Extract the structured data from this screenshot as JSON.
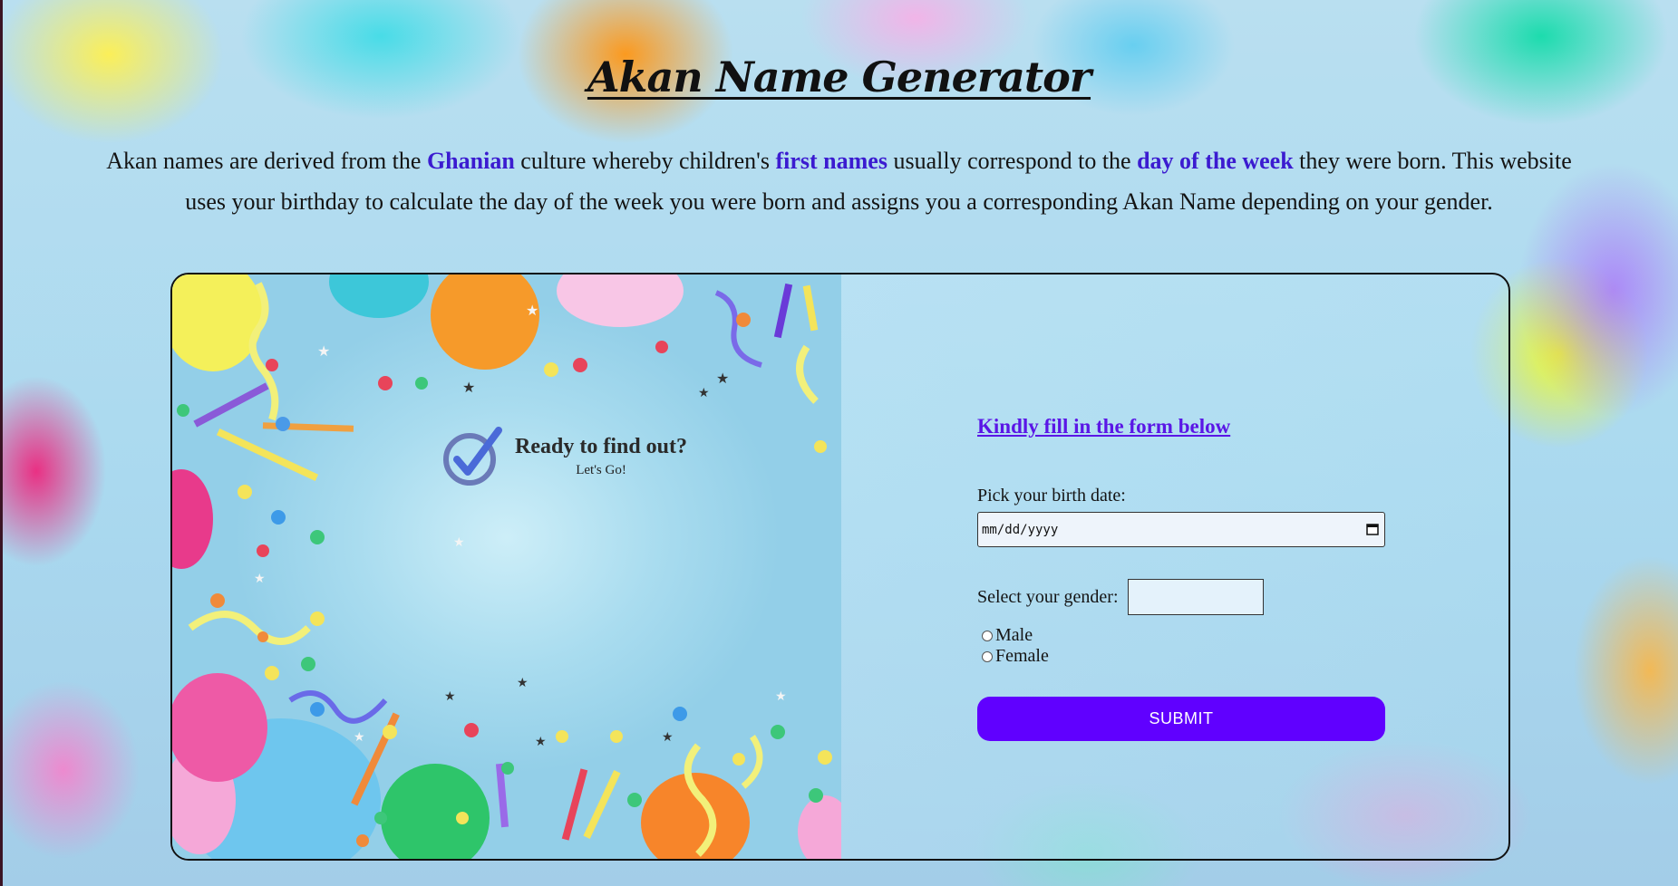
{
  "header": {
    "title": "Akan Name Generator"
  },
  "intro": {
    "part1": "Akan names are derived from the ",
    "highlight1": "Ghanian",
    "part2": " culture whereby children's ",
    "highlight2": "first names",
    "part3": " usually correspond to the ",
    "highlight3": "day of the week",
    "part4": " they were born. This website uses your birthday to calculate the day of the week you were born and assigns you a corresponding Akan Name depending on your gender."
  },
  "hero": {
    "heading": "Ready to find out?",
    "subheading": "Let's Go!"
  },
  "form": {
    "title": "Kindly fill in the form below",
    "birthdate_label": "Pick your birth date:",
    "birthdate_placeholder": "mm/dd/yyyy",
    "gender_label": "Select your gender:",
    "gender_options": [
      "Male",
      "Female"
    ],
    "submit_label": "SUBMIT"
  },
  "colors": {
    "accent": "#6000ff",
    "highlight_text": "#3b1bd0",
    "form_title": "#5a16e6"
  }
}
